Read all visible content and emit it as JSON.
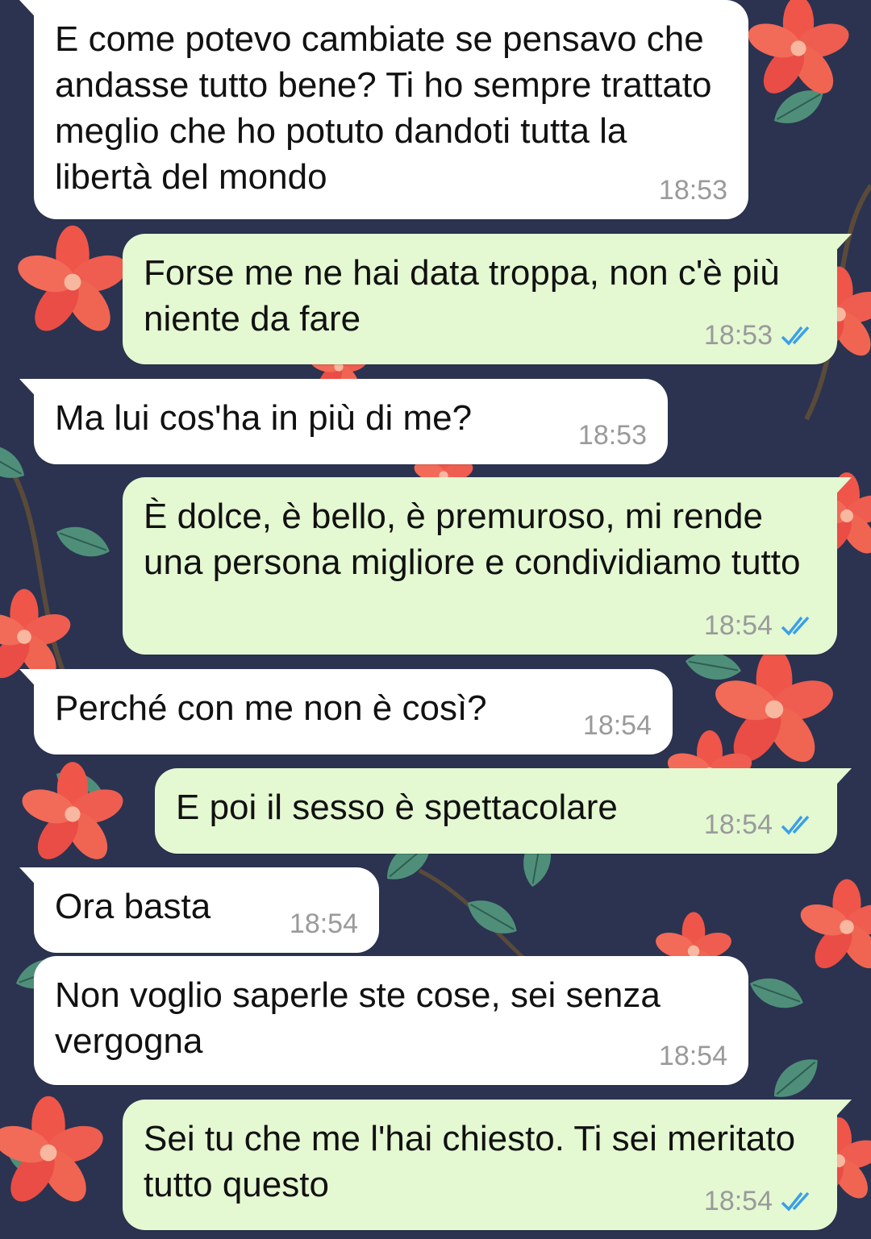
{
  "colors": {
    "incoming_bubble": "#ffffff",
    "outgoing_bubble": "#e4f8d2",
    "time_text": "#9a9a9a",
    "read_ticks": "#3aa0e8",
    "wallpaper_base": "#2b3350",
    "flower": "#f0554a",
    "leaf": "#4f8f7a"
  },
  "icons": {
    "read_receipt": "double-check-icon"
  },
  "messages": [
    {
      "direction": "in",
      "text": "E come potevo cambiate se pensavo che andasse tutto bene? Ti ho sempre trattato meglio che ho potuto dandoti tutta la libertà del mondo",
      "time": "18:53"
    },
    {
      "direction": "out",
      "text": "Forse me ne hai data troppa, non c'è più niente da fare",
      "time": "18:53",
      "read": true
    },
    {
      "direction": "in",
      "text": "Ma lui cos'ha in più di me?",
      "time": "18:53"
    },
    {
      "direction": "out",
      "text": "È dolce, è bello, è premuroso, mi rende una persona migliore e condividiamo tutto",
      "time": "18:54",
      "read": true
    },
    {
      "direction": "in",
      "text": "Perché con me non è così?",
      "time": "18:54"
    },
    {
      "direction": "out",
      "text": "E poi il sesso è spettacolare",
      "time": "18:54",
      "read": true
    },
    {
      "direction": "in",
      "text": "Ora basta",
      "time": "18:54"
    },
    {
      "direction": "in",
      "text": "Non voglio saperle ste cose, sei senza vergogna",
      "time": "18:54"
    },
    {
      "direction": "out",
      "text": "Sei tu che me l'hai chiesto. Ti sei meritato tutto questo",
      "time": "18:54",
      "read": true
    }
  ]
}
